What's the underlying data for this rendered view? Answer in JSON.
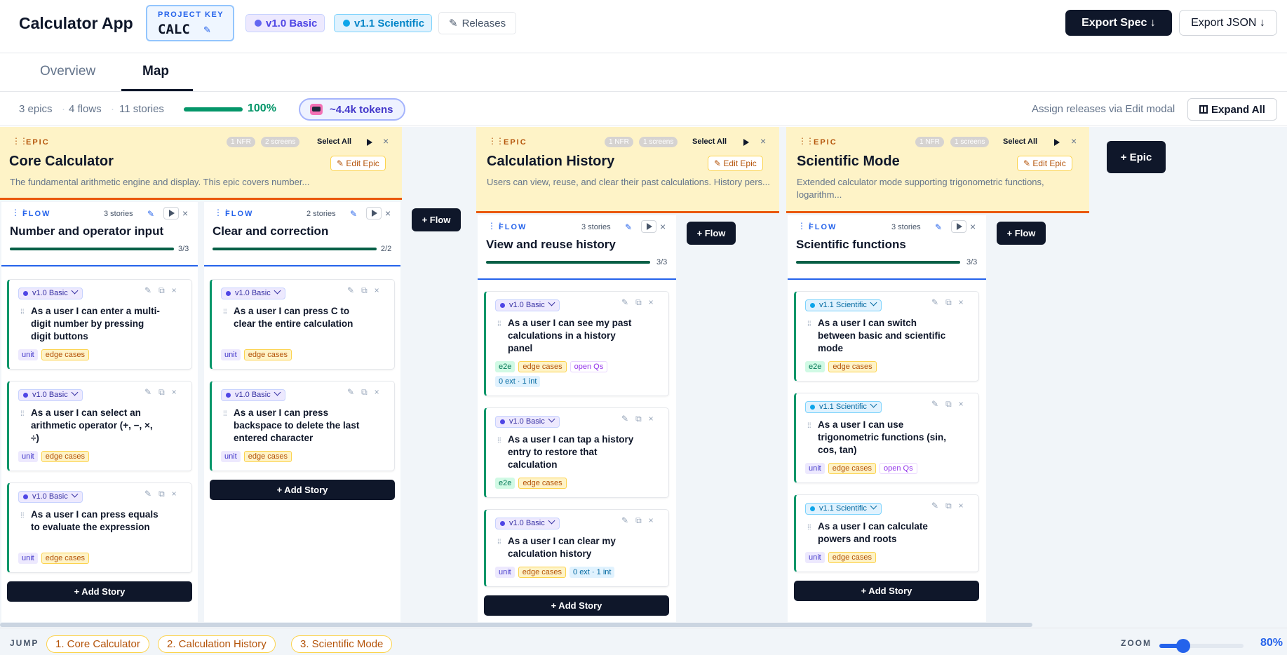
{
  "header": {
    "app_title": "Calculator App",
    "project_key_label": "PROJECT KEY",
    "project_key": "CALC",
    "releases": [
      {
        "name": "v1.0 Basic",
        "color": "#6366f1"
      },
      {
        "name": "v1.1 Scientific",
        "color": "#0ea5e9"
      }
    ],
    "releases_button": "Releases",
    "export_spec": "Export Spec ↓",
    "export_json": "Export JSON ↓"
  },
  "tabs": {
    "overview": "Overview",
    "map": "Map",
    "active": "Map"
  },
  "stats": {
    "epics": "3 epics",
    "flows": "4 flows",
    "stories": "11 stories",
    "progress": 100,
    "progress_label": "100%",
    "tokens": "~4.4k tokens",
    "assign_hint": "Assign releases via Edit modal",
    "expand_all": "Expand All"
  },
  "labels": {
    "epic": "EPIC",
    "flow": "FLOW",
    "select_all": "Select All",
    "edit_epic": "Edit Epic",
    "add_story": "+ Add Story",
    "add_flow": "+ Flow",
    "add_epic": "+ Epic"
  },
  "epics": [
    {
      "title": "Core Calculator",
      "nfr": "1 NFR",
      "screens": "2 screens",
      "description": "The fundamental arithmetic engine and display. This epic covers number...",
      "flows": [
        {
          "title": "Number and operator input",
          "stories_count": "3 stories",
          "ratio": "3/3",
          "progress": 1.0,
          "stories": [
            {
              "release": "v1.0 Basic",
              "text": "As a user I can enter a multi-digit number by pressing digit buttons",
              "tags": [
                "unit",
                "edge cases"
              ]
            },
            {
              "release": "v1.0 Basic",
              "text": "As a user I can select an arithmetic operator (+, −, ×, ÷)",
              "tags": [
                "unit",
                "edge cases"
              ]
            },
            {
              "release": "v1.0 Basic",
              "text": "As a user I can press equals to evaluate the expression",
              "tags": [
                "unit",
                "edge cases"
              ]
            }
          ]
        },
        {
          "title": "Clear and correction",
          "stories_count": "2 stories",
          "ratio": "2/2",
          "progress": 1.0,
          "stories": [
            {
              "release": "v1.0 Basic",
              "text": "As a user I can press C to clear the entire calculation",
              "tags": [
                "unit",
                "edge cases"
              ]
            },
            {
              "release": "v1.0 Basic",
              "text": "As a user I can press backspace to delete the last entered character",
              "tags": [
                "unit",
                "edge cases"
              ]
            }
          ]
        }
      ]
    },
    {
      "title": "Calculation History",
      "nfr": "1 NFR",
      "screens": "1 screens",
      "description": "Users can view, reuse, and clear their past calculations. History pers...",
      "flows": [
        {
          "title": "View and reuse history",
          "stories_count": "3 stories",
          "ratio": "3/3",
          "progress": 1.0,
          "stories": [
            {
              "release": "v1.0 Basic",
              "text": "As a user I can see my past calculations in a history panel",
              "tags": [
                "e2e",
                "edge cases",
                "open Qs",
                "0 ext · 1 int"
              ]
            },
            {
              "release": "v1.0 Basic",
              "text": "As a user I can tap a history entry to restore that calculation",
              "tags": [
                "e2e",
                "edge cases"
              ]
            },
            {
              "release": "v1.0 Basic",
              "text": "As a user I can clear my calculation history",
              "tags": [
                "unit",
                "edge cases",
                "0 ext · 1 int"
              ]
            }
          ]
        }
      ]
    },
    {
      "title": "Scientific Mode",
      "nfr": "1 NFR",
      "screens": "1 screens",
      "description": "Extended calculator mode supporting trigonometric functions, logarithm...",
      "flows": [
        {
          "title": "Scientific functions",
          "stories_count": "3 stories",
          "ratio": "3/3",
          "progress": 1.0,
          "stories": [
            {
              "release": "v1.1 Scientific",
              "text": "As a user I can switch between basic and scientific mode",
              "tags": [
                "e2e",
                "edge cases"
              ]
            },
            {
              "release": "v1.1 Scientific",
              "text": "As a user I can use trigonometric functions (sin, cos, tan)",
              "tags": [
                "unit",
                "edge cases",
                "open Qs"
              ]
            },
            {
              "release": "v1.1 Scientific",
              "text": "As a user I can calculate powers and roots",
              "tags": [
                "unit",
                "edge cases"
              ]
            }
          ]
        }
      ]
    }
  ],
  "footer": {
    "jump_label": "JUMP",
    "jump_items": [
      "1. Core Calculator",
      "2. Calculation History",
      "3. Scientific Mode"
    ],
    "zoom_label": "ZOOM",
    "zoom_value": "80%",
    "zoom_fraction": 0.28
  }
}
